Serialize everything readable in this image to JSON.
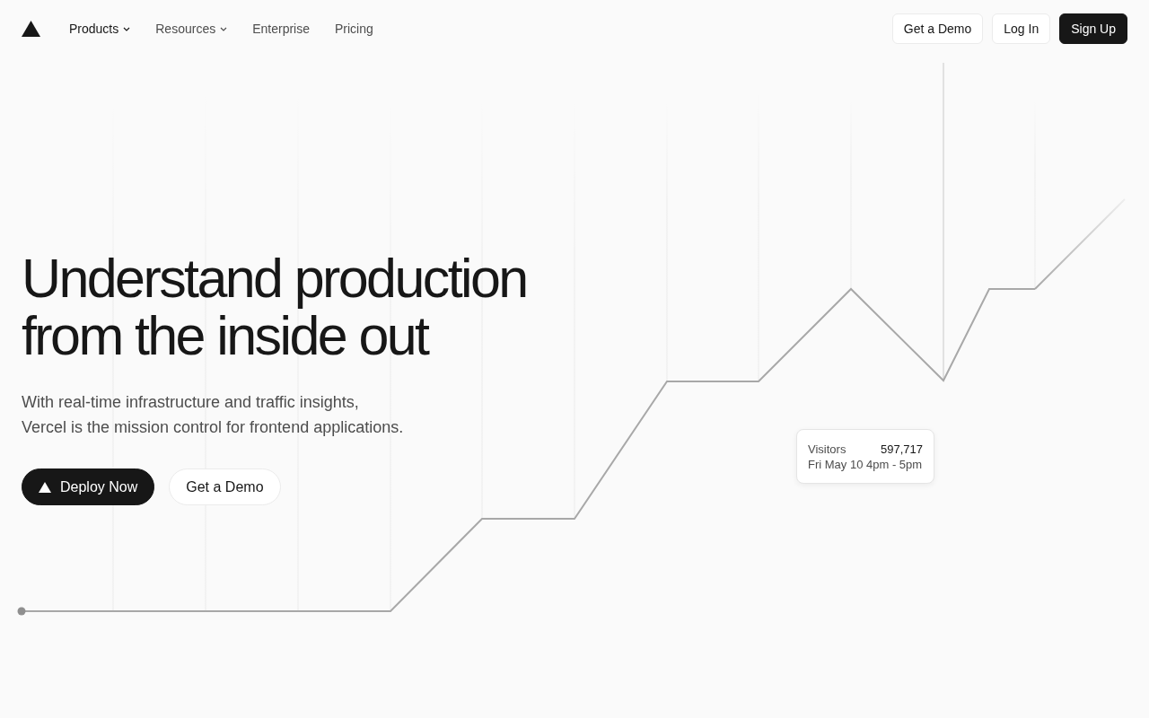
{
  "nav": {
    "items": [
      {
        "label": "Products",
        "has_menu": true,
        "selected": true
      },
      {
        "label": "Resources",
        "has_menu": true,
        "selected": false
      },
      {
        "label": "Enterprise",
        "has_menu": false,
        "selected": false
      },
      {
        "label": "Pricing",
        "has_menu": false,
        "selected": false
      }
    ],
    "actions": [
      {
        "label": "Get a Demo",
        "kind": "outline"
      },
      {
        "label": "Log In",
        "kind": "outline"
      },
      {
        "label": "Sign Up",
        "kind": "solid"
      }
    ]
  },
  "hero": {
    "title_lines": [
      "Understand production",
      "from the inside out"
    ],
    "subtitle_lines": [
      "With real-time infrastructure and traffic insights,",
      "Vercel is the mission control for frontend applications."
    ],
    "actions": [
      {
        "label": "Deploy Now",
        "kind": "solid"
      },
      {
        "label": "Get a Demo",
        "kind": "outline"
      }
    ]
  },
  "tooltip": {
    "label": "Visitors",
    "value": "597,717",
    "time": "Fri May 10 4pm - 5pm"
  }
}
